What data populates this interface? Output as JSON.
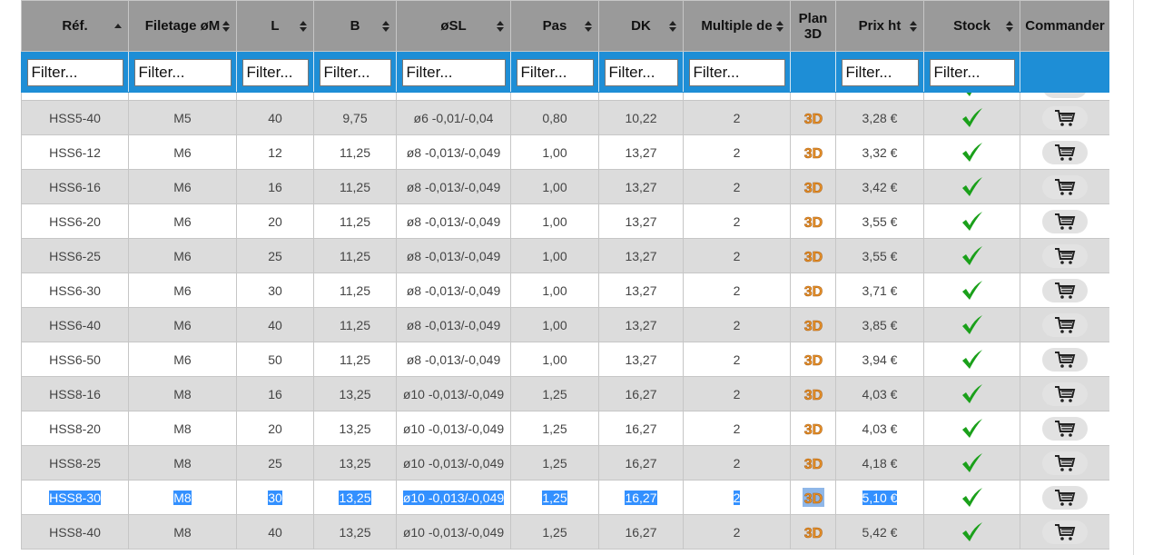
{
  "columns": [
    {
      "label": "Réf.",
      "sort": "asc"
    },
    {
      "label": "Filetage øM",
      "sort": "both"
    },
    {
      "label": "L",
      "sort": "both"
    },
    {
      "label": "B",
      "sort": "both"
    },
    {
      "label": "øSL",
      "sort": "both"
    },
    {
      "label": "Pas",
      "sort": "both"
    },
    {
      "label": "DK",
      "sort": "both"
    },
    {
      "label": "Multiple de",
      "sort": "both"
    },
    {
      "label": "Plan 3D",
      "sort": "none"
    },
    {
      "label": "Prix ht",
      "sort": "both"
    },
    {
      "label": "Stock",
      "sort": "both"
    },
    {
      "label": "Commander",
      "sort": "none"
    }
  ],
  "filter_placeholder": "Filter...",
  "colors": {
    "header_bg": "#9a9a9a",
    "filter_bar": "#1e8ed6",
    "row_alt": "#dcdcdc",
    "selection": "#3390ff",
    "check": "#1aa01a",
    "icon_3d": "#e8922a"
  },
  "rows": [
    {
      "ref": "HSS5-40",
      "filetage": "M5",
      "L": "40",
      "B": "9,75",
      "osl": "ø6 -0,01/-0,04",
      "pas": "0,80",
      "dk": "10,22",
      "multiple": "2",
      "prix": "3,28 €"
    },
    {
      "ref": "HSS6-12",
      "filetage": "M6",
      "L": "12",
      "B": "11,25",
      "osl": "ø8 -0,013/-0,049",
      "pas": "1,00",
      "dk": "13,27",
      "multiple": "2",
      "prix": "3,32 €"
    },
    {
      "ref": "HSS6-16",
      "filetage": "M6",
      "L": "16",
      "B": "11,25",
      "osl": "ø8 -0,013/-0,049",
      "pas": "1,00",
      "dk": "13,27",
      "multiple": "2",
      "prix": "3,42 €"
    },
    {
      "ref": "HSS6-20",
      "filetage": "M6",
      "L": "20",
      "B": "11,25",
      "osl": "ø8 -0,013/-0,049",
      "pas": "1,00",
      "dk": "13,27",
      "multiple": "2",
      "prix": "3,55 €"
    },
    {
      "ref": "HSS6-25",
      "filetage": "M6",
      "L": "25",
      "B": "11,25",
      "osl": "ø8 -0,013/-0,049",
      "pas": "1,00",
      "dk": "13,27",
      "multiple": "2",
      "prix": "3,55 €"
    },
    {
      "ref": "HSS6-30",
      "filetage": "M6",
      "L": "30",
      "B": "11,25",
      "osl": "ø8 -0,013/-0,049",
      "pas": "1,00",
      "dk": "13,27",
      "multiple": "2",
      "prix": "3,71 €"
    },
    {
      "ref": "HSS6-40",
      "filetage": "M6",
      "L": "40",
      "B": "11,25",
      "osl": "ø8 -0,013/-0,049",
      "pas": "1,00",
      "dk": "13,27",
      "multiple": "2",
      "prix": "3,85 €"
    },
    {
      "ref": "HSS6-50",
      "filetage": "M6",
      "L": "50",
      "B": "11,25",
      "osl": "ø8 -0,013/-0,049",
      "pas": "1,00",
      "dk": "13,27",
      "multiple": "2",
      "prix": "3,94 €"
    },
    {
      "ref": "HSS8-16",
      "filetage": "M8",
      "L": "16",
      "B": "13,25",
      "osl": "ø10 -0,013/-0,049",
      "pas": "1,25",
      "dk": "16,27",
      "multiple": "2",
      "prix": "4,03 €"
    },
    {
      "ref": "HSS8-20",
      "filetage": "M8",
      "L": "20",
      "B": "13,25",
      "osl": "ø10 -0,013/-0,049",
      "pas": "1,25",
      "dk": "16,27",
      "multiple": "2",
      "prix": "4,03 €"
    },
    {
      "ref": "HSS8-25",
      "filetage": "M8",
      "L": "25",
      "B": "13,25",
      "osl": "ø10 -0,013/-0,049",
      "pas": "1,25",
      "dk": "16,27",
      "multiple": "2",
      "prix": "4,18 €"
    },
    {
      "ref": "HSS8-30",
      "filetage": "M8",
      "L": "30",
      "B": "13,25",
      "osl": "ø10 -0,013/-0,049",
      "pas": "1,25",
      "dk": "16,27",
      "multiple": "2",
      "prix": "5,10 €",
      "selected": true
    },
    {
      "ref": "HSS8-40",
      "filetage": "M8",
      "L": "40",
      "B": "13,25",
      "osl": "ø10 -0,013/-0,049",
      "pas": "1,25",
      "dk": "16,27",
      "multiple": "2",
      "prix": "5,42 €"
    }
  ]
}
